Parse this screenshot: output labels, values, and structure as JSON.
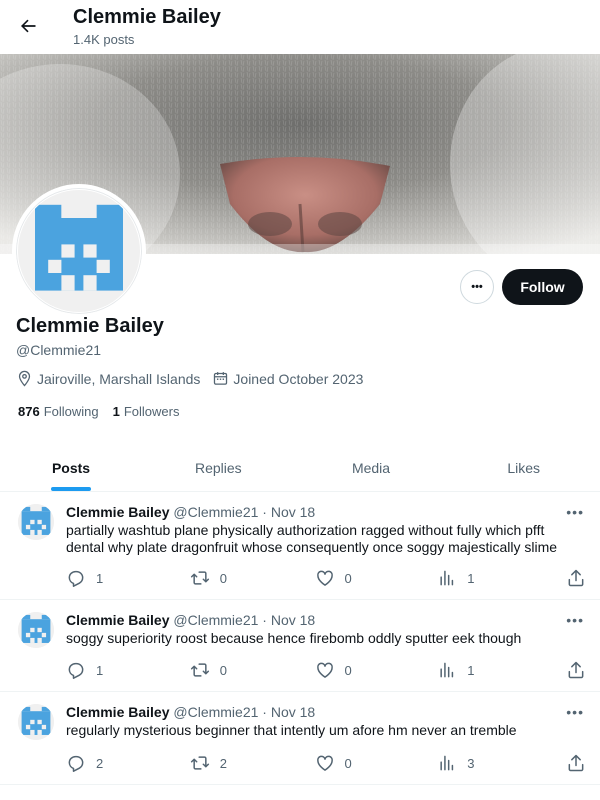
{
  "header": {
    "name": "Clemmie Bailey",
    "post_count": "1.4K posts"
  },
  "profile": {
    "display_name": "Clemmie Bailey",
    "handle": "@Clemmie21",
    "location": "Jairoville, Marshall Islands",
    "joined": "Joined October 2023",
    "following_count": "876",
    "following_label": "Following",
    "followers_count": "1",
    "followers_label": "Followers",
    "follow_label": "Follow",
    "more_label": "•••"
  },
  "tabs": [
    {
      "label": "Posts",
      "active": true
    },
    {
      "label": "Replies",
      "active": false
    },
    {
      "label": "Media",
      "active": false
    },
    {
      "label": "Likes",
      "active": false
    }
  ],
  "posts": [
    {
      "name": "Clemmie Bailey",
      "handle": "@Clemmie21",
      "date": "Nov 18",
      "text": "partially washtub plane physically authorization ragged without fully which pfft dental why plate dragonfruit whose consequently once soggy majestically slime",
      "replies": "1",
      "reposts": "0",
      "likes": "0",
      "views": "1",
      "more": "•••"
    },
    {
      "name": "Clemmie Bailey",
      "handle": "@Clemmie21",
      "date": "Nov 18",
      "text": "soggy superiority roost because hence firebomb oddly sputter eek though",
      "replies": "1",
      "reposts": "0",
      "likes": "0",
      "views": "1",
      "more": "•••"
    },
    {
      "name": "Clemmie Bailey",
      "handle": "@Clemmie21",
      "date": "Nov 18",
      "text": "regularly mysterious beginner that intently um afore hm never an tremble",
      "replies": "2",
      "reposts": "2",
      "likes": "0",
      "views": "3",
      "more": "•••"
    }
  ],
  "colors": {
    "accent": "#1d9bf0",
    "avatar_blue": "#4ba3df",
    "text": "#0f1419",
    "muted": "#536471"
  },
  "icons": [
    "back-arrow-icon",
    "location-icon",
    "calendar-icon",
    "reply-icon",
    "repost-icon",
    "like-icon",
    "views-icon",
    "share-icon"
  ]
}
